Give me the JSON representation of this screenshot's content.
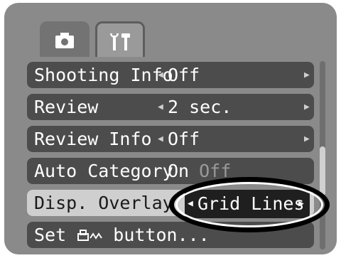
{
  "tabs": [
    {
      "name": "camera",
      "icon": "camera-icon"
    },
    {
      "name": "setup",
      "icon": "setup-tools-icon"
    }
  ],
  "menu": {
    "rows": [
      {
        "label": "Shooting Info",
        "value": "Off"
      },
      {
        "label": "Review",
        "value": "2 sec."
      },
      {
        "label": "Review Info",
        "value": "Off"
      },
      {
        "label": "Auto Category",
        "value": "On",
        "alt": "Off"
      },
      {
        "label": "Disp. Overlay",
        "value": "Grid Lines"
      },
      {
        "label": "Set ",
        "icon": "print-share-icon",
        "suffix": " button..."
      }
    ]
  },
  "arrows": {
    "left": "◀",
    "right": "▶"
  },
  "colors": {
    "screen": "#8a8a8a",
    "row": "#4c4c4c",
    "selected_row": "#cfcfcf",
    "selection_box": "#1f1f1f"
  }
}
